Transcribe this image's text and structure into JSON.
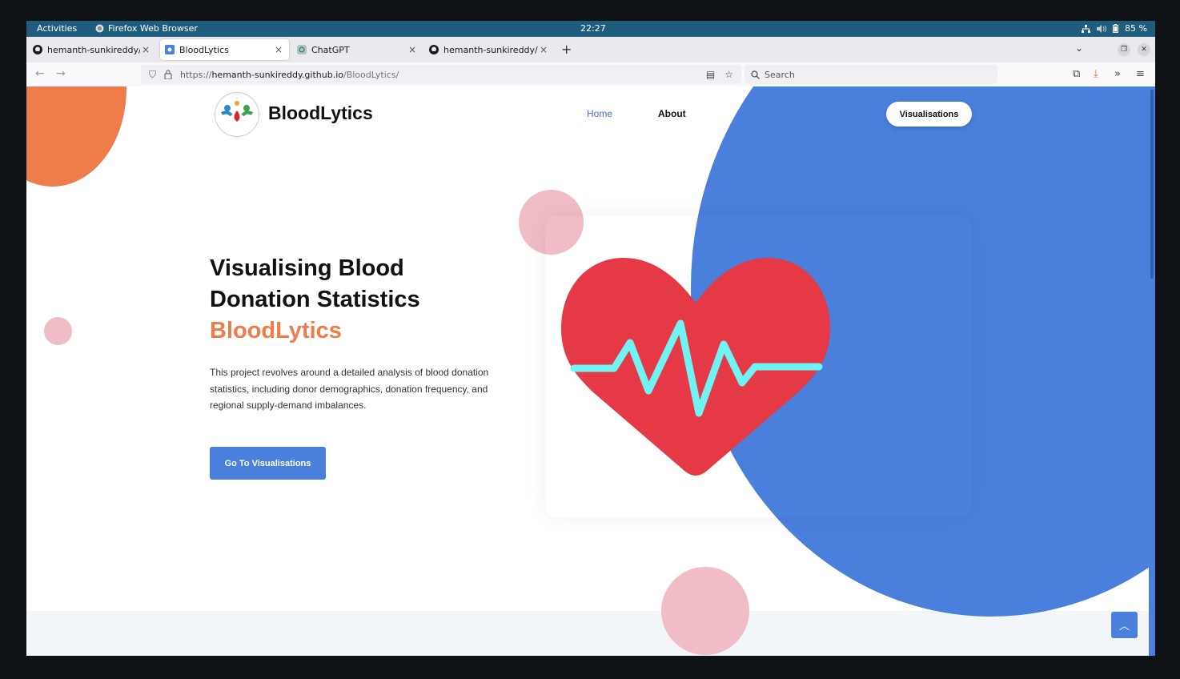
{
  "system_bar": {
    "activities": "Activities",
    "app_name": "Firefox Web Browser",
    "clock": "22:27",
    "battery": "85 %"
  },
  "browser": {
    "tabs": [
      {
        "label": "hemanth-sunkireddy/Blo",
        "icon": "github-icon",
        "active": false
      },
      {
        "label": "BloodLytics",
        "icon": "site-icon",
        "active": true
      },
      {
        "label": "ChatGPT",
        "icon": "chatgpt-icon",
        "active": false
      },
      {
        "label": "hemanth-sunkireddy/Per",
        "icon": "github-icon",
        "active": false
      }
    ],
    "url_prefix": "https://",
    "url_host": "hemanth-sunkireddy.github.io",
    "url_path": "/BloodLytics/",
    "search_placeholder": "Search"
  },
  "site": {
    "brand": "BloodLytics",
    "nav": {
      "home": "Home",
      "about": "About",
      "cta": "Visualisations"
    },
    "hero": {
      "line1": "Visualising Blood",
      "line2": "Donation Statistics",
      "line3": "BloodLytics",
      "description": "This project revolves around a detailed analysis of blood donation statistics, including donor demographics, donation frequency, and regional supply-demand imbalances.",
      "button": "Go To Visualisations"
    },
    "colors": {
      "accent_blue": "#4a7fdb",
      "accent_orange": "#ee7d4b",
      "heart_red": "#e63946",
      "pulse_cyan": "#6ff3f3",
      "pink_dot": "#f0bcc6"
    }
  }
}
